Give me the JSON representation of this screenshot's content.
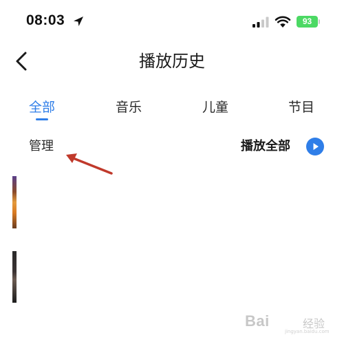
{
  "status_bar": {
    "time": "08:03",
    "battery": "93",
    "icons": [
      "location-arrow-icon",
      "cellular-signal-icon",
      "wifi-icon",
      "battery-icon"
    ],
    "battery_color": "#4cd964"
  },
  "header": {
    "title": "播放历史",
    "back_icon": "chevron-left-icon"
  },
  "tabs": [
    {
      "label": "全部",
      "active": true
    },
    {
      "label": "音乐",
      "active": false
    },
    {
      "label": "儿童",
      "active": false
    },
    {
      "label": "节目",
      "active": false
    }
  ],
  "toolbar": {
    "manage_label": "管理",
    "play_all_label": "播放全部",
    "play_icon": "play-circle-icon"
  },
  "annotation": {
    "icon": "red-arrow-icon",
    "color": "#c0392b"
  },
  "watermark": {
    "text": "Bai",
    "sub": "经验",
    "url": "jingyan.baidu.com"
  },
  "colors": {
    "accent": "#2f7ee8",
    "text": "#1a1a1a"
  }
}
